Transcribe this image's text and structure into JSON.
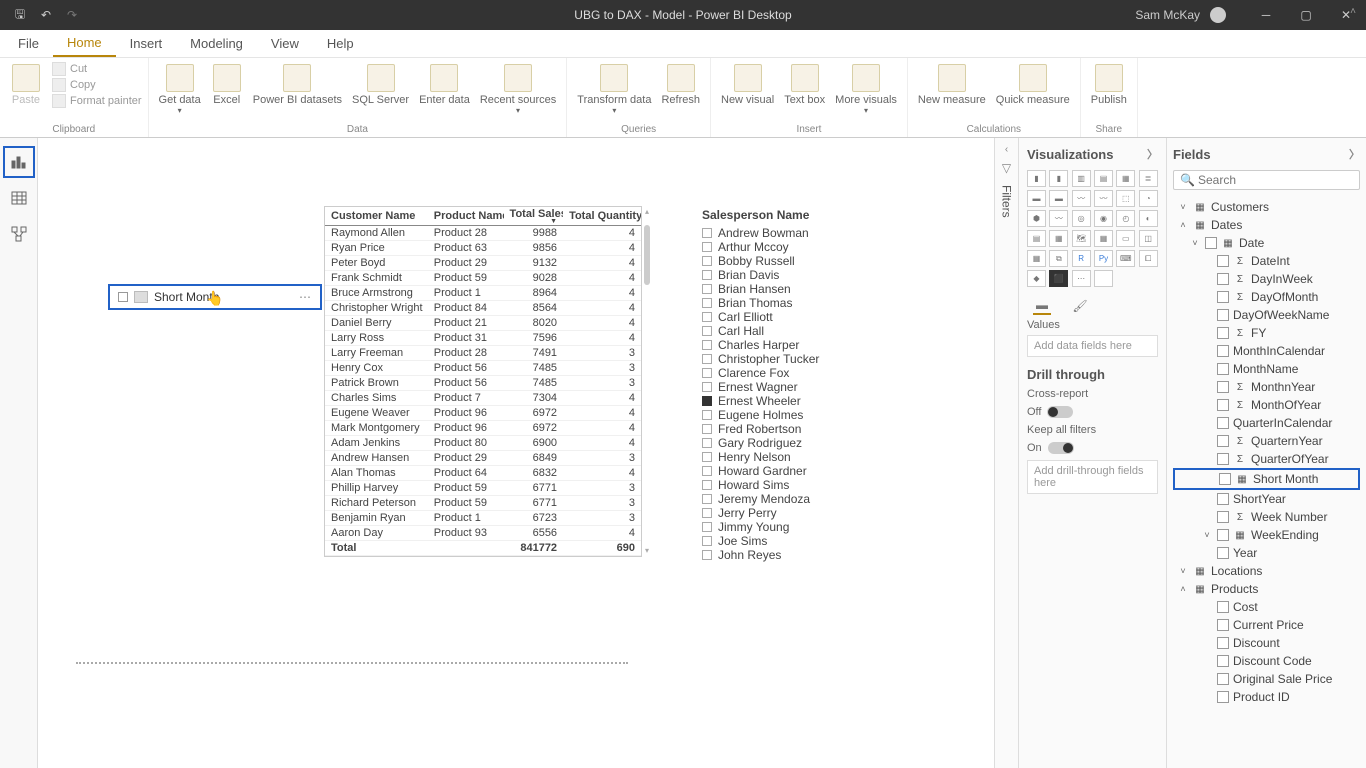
{
  "title_bar": {
    "document_title": "UBG to DAX - Model - Power BI Desktop",
    "user": "Sam McKay"
  },
  "ribbon_tabs": {
    "file": "File",
    "home": "Home",
    "insert": "Insert",
    "modeling": "Modeling",
    "view": "View",
    "help": "Help"
  },
  "ribbon": {
    "clipboard": {
      "paste": "Paste",
      "cut": "Cut",
      "copy": "Copy",
      "format_painter": "Format painter",
      "group_label": "Clipboard"
    },
    "data": {
      "get_data": "Get data",
      "excel": "Excel",
      "pbi_datasets": "Power BI datasets",
      "sql": "SQL Server",
      "enter_data": "Enter data",
      "recent": "Recent sources",
      "group_label": "Data"
    },
    "queries": {
      "transform": "Transform data",
      "refresh": "Refresh",
      "group_label": "Queries"
    },
    "insert": {
      "new_visual": "New visual",
      "text_box": "Text box",
      "more_visuals": "More visuals",
      "group_label": "Insert"
    },
    "calculations": {
      "new_measure": "New measure",
      "quick_measure": "Quick measure",
      "group_label": "Calculations"
    },
    "share": {
      "publish": "Publish",
      "group_label": "Share"
    }
  },
  "filters_label": "Filters",
  "viz_panel": {
    "header": "Visualizations",
    "values_label": "Values",
    "values_placeholder": "Add data fields here",
    "drill_header": "Drill through",
    "cross_report": "Cross-report",
    "off": "Off",
    "keep_filters": "Keep all filters",
    "on": "On",
    "drill_placeholder": "Add drill-through fields here"
  },
  "fields_panel": {
    "header": "Fields",
    "search_placeholder": "Search",
    "tables": {
      "customers": "Customers",
      "dates": "Dates",
      "locations": "Locations",
      "products": "Products"
    },
    "dates_children": {
      "date": "Date",
      "dateint": "DateInt",
      "dayinweek": "DayInWeek",
      "dayofmonth": "DayOfMonth",
      "dayofweekname": "DayOfWeekName",
      "fy": "FY",
      "monthincalendar": "MonthInCalendar",
      "monthname": "MonthName",
      "monthnyear": "MonthnYear",
      "monthofyear": "MonthOfYear",
      "quarterincalendar": "QuarterInCalendar",
      "quarternyear": "QuarternYear",
      "quarterofyear": "QuarterOfYear",
      "shortmonth": "Short Month",
      "shortyear": "ShortYear",
      "weeknumber": "Week Number",
      "weekending": "WeekEnding",
      "year": "Year"
    },
    "products_children": {
      "cost": "Cost",
      "current_price": "Current Price",
      "discount": "Discount",
      "discount_code": "Discount Code",
      "original_sale_price": "Original Sale Price",
      "product_id": "Product ID"
    }
  },
  "selected_visual": {
    "label": "Short Month"
  },
  "table_visual": {
    "headers": {
      "customer": "Customer Name",
      "product": "Product Name",
      "sales": "Total Sales",
      "qty": "Total Quantity"
    },
    "rows": [
      {
        "c": "Raymond Allen",
        "p": "Product 28",
        "s": "9988",
        "q": "4"
      },
      {
        "c": "Ryan Price",
        "p": "Product 63",
        "s": "9856",
        "q": "4"
      },
      {
        "c": "Peter Boyd",
        "p": "Product 29",
        "s": "9132",
        "q": "4"
      },
      {
        "c": "Frank Schmidt",
        "p": "Product 59",
        "s": "9028",
        "q": "4"
      },
      {
        "c": "Bruce Armstrong",
        "p": "Product 1",
        "s": "8964",
        "q": "4"
      },
      {
        "c": "Christopher Wright",
        "p": "Product 84",
        "s": "8564",
        "q": "4"
      },
      {
        "c": "Daniel Berry",
        "p": "Product 21",
        "s": "8020",
        "q": "4"
      },
      {
        "c": "Larry Ross",
        "p": "Product 31",
        "s": "7596",
        "q": "4"
      },
      {
        "c": "Larry Freeman",
        "p": "Product 28",
        "s": "7491",
        "q": "3"
      },
      {
        "c": "Henry Cox",
        "p": "Product 56",
        "s": "7485",
        "q": "3"
      },
      {
        "c": "Patrick Brown",
        "p": "Product 56",
        "s": "7485",
        "q": "3"
      },
      {
        "c": "Charles Sims",
        "p": "Product 7",
        "s": "7304",
        "q": "4"
      },
      {
        "c": "Eugene Weaver",
        "p": "Product 96",
        "s": "6972",
        "q": "4"
      },
      {
        "c": "Mark Montgomery",
        "p": "Product 96",
        "s": "6972",
        "q": "4"
      },
      {
        "c": "Adam Jenkins",
        "p": "Product 80",
        "s": "6900",
        "q": "4"
      },
      {
        "c": "Andrew Hansen",
        "p": "Product 29",
        "s": "6849",
        "q": "3"
      },
      {
        "c": "Alan Thomas",
        "p": "Product 64",
        "s": "6832",
        "q": "4"
      },
      {
        "c": "Phillip Harvey",
        "p": "Product 59",
        "s": "6771",
        "q": "3"
      },
      {
        "c": "Richard Peterson",
        "p": "Product 59",
        "s": "6771",
        "q": "3"
      },
      {
        "c": "Benjamin Ryan",
        "p": "Product 1",
        "s": "6723",
        "q": "3"
      },
      {
        "c": "Aaron Day",
        "p": "Product 93",
        "s": "6556",
        "q": "4"
      }
    ],
    "footer": {
      "label": "Total",
      "sales": "841772",
      "qty": "690"
    }
  },
  "slicer": {
    "title": "Salesperson Name",
    "items": [
      {
        "name": "Andrew Bowman",
        "checked": false
      },
      {
        "name": "Arthur Mccoy",
        "checked": false
      },
      {
        "name": "Bobby Russell",
        "checked": false
      },
      {
        "name": "Brian Davis",
        "checked": false
      },
      {
        "name": "Brian Hansen",
        "checked": false
      },
      {
        "name": "Brian Thomas",
        "checked": false
      },
      {
        "name": "Carl Elliott",
        "checked": false
      },
      {
        "name": "Carl Hall",
        "checked": false
      },
      {
        "name": "Charles Harper",
        "checked": false
      },
      {
        "name": "Christopher Tucker",
        "checked": false
      },
      {
        "name": "Clarence Fox",
        "checked": false
      },
      {
        "name": "Ernest Wagner",
        "checked": false
      },
      {
        "name": "Ernest Wheeler",
        "checked": true
      },
      {
        "name": "Eugene Holmes",
        "checked": false
      },
      {
        "name": "Fred Robertson",
        "checked": false
      },
      {
        "name": "Gary Rodriguez",
        "checked": false
      },
      {
        "name": "Henry Nelson",
        "checked": false
      },
      {
        "name": "Howard Gardner",
        "checked": false
      },
      {
        "name": "Howard Sims",
        "checked": false
      },
      {
        "name": "Jeremy Mendoza",
        "checked": false
      },
      {
        "name": "Jerry Perry",
        "checked": false
      },
      {
        "name": "Jimmy Young",
        "checked": false
      },
      {
        "name": "Joe Sims",
        "checked": false
      },
      {
        "name": "John Reyes",
        "checked": false
      }
    ]
  }
}
